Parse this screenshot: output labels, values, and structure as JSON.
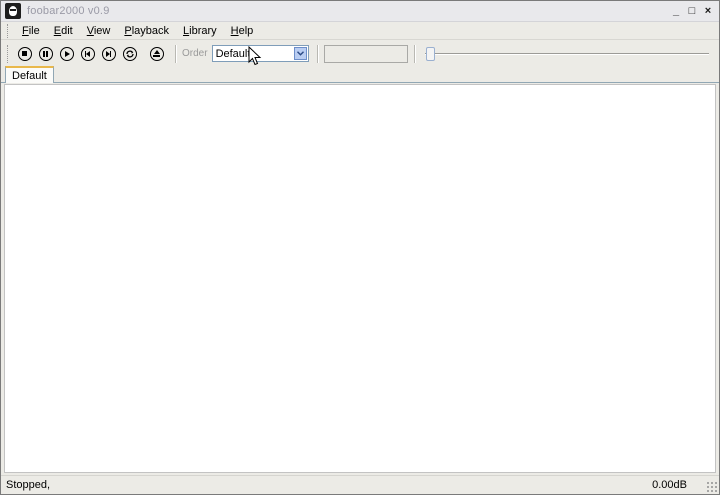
{
  "window": {
    "title": "foobar2000 v0.9",
    "controls": {
      "minimize": "_",
      "maximize": "□",
      "close": "×"
    }
  },
  "menu": {
    "items": [
      {
        "label": "File"
      },
      {
        "label": "Edit"
      },
      {
        "label": "View"
      },
      {
        "label": "Playback"
      },
      {
        "label": "Library"
      },
      {
        "label": "Help"
      }
    ]
  },
  "toolbar": {
    "buttons": [
      "stop-icon",
      "pause-icon",
      "play-icon",
      "previous-icon",
      "next-icon",
      "random-icon",
      "eject-icon"
    ],
    "order_label": "Order",
    "order_value": "Default",
    "seek_position": 0
  },
  "tabs": [
    {
      "label": "Default",
      "active": true
    }
  ],
  "status": {
    "text": "Stopped,",
    "volume": "0.00dB"
  },
  "colors": {
    "tab_accent": "#e9b84b",
    "dropdown_arrow": "#b9cdf2",
    "window_bg": "#ecebe6"
  }
}
